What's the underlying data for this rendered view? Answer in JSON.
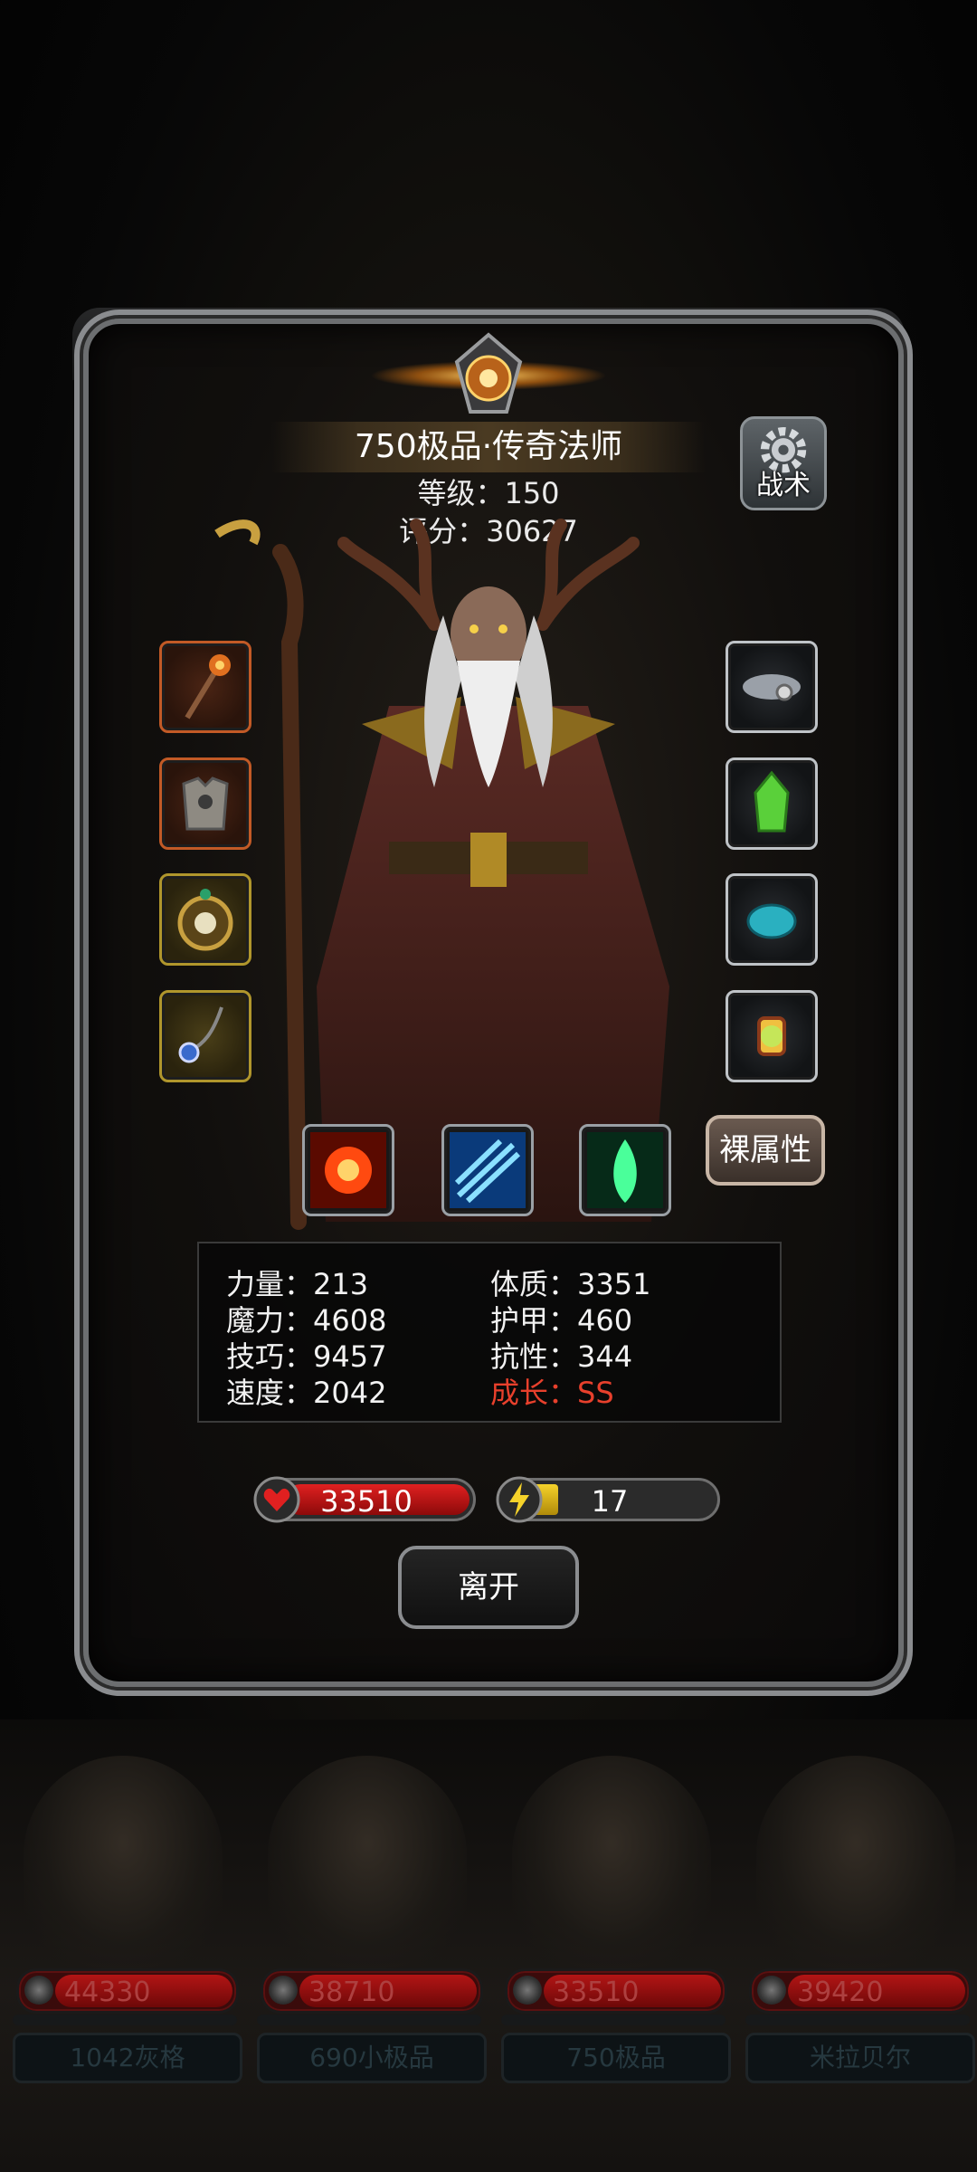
{
  "header": {
    "title": "750极品·传奇法师",
    "level_text": "等级：150",
    "score_text": "评分：30627",
    "tactic_label": "战术"
  },
  "equipment": {
    "left": [
      "staff-icon",
      "armor-icon",
      "medal-icon",
      "necklace-icon"
    ],
    "right": [
      "cloud-ring-icon",
      "green-gem-icon",
      "blue-stone-icon",
      "lantern-icon"
    ]
  },
  "skills": [
    "fire-burst-icon",
    "ice-slash-icon",
    "green-flame-icon"
  ],
  "raw_attr_label": "裸属性",
  "stats": {
    "strength": "力量：213",
    "magic": "魔力：4608",
    "skill": "技巧：9457",
    "speed": "速度：2042",
    "constitution": "体质：3351",
    "armor": "护甲：460",
    "resistance": "抗性：344",
    "growth": "成长：SS"
  },
  "hp": "33510",
  "energy": "17",
  "leave_label": "离开",
  "roster": [
    {
      "hp": "44330",
      "name": "1042灰格"
    },
    {
      "hp": "38710",
      "name": "690小极品"
    },
    {
      "hp": "33510",
      "name": "750极品"
    },
    {
      "hp": "39420",
      "name": "米拉贝尔"
    }
  ],
  "colors": {
    "growth": "#e8402c",
    "hp_bar": "#d41a1a",
    "energy_bar": "#f2cf25"
  }
}
